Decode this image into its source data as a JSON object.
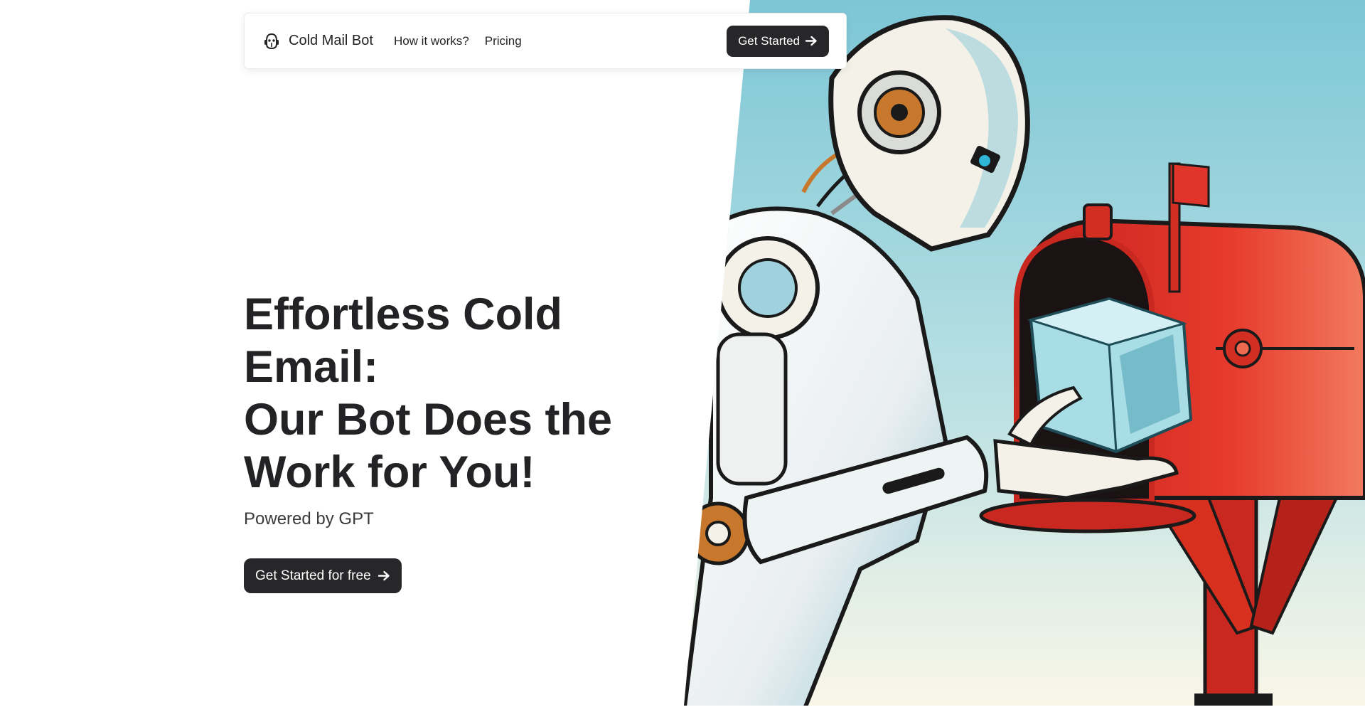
{
  "nav": {
    "brand_name": "Cold Mail Bot",
    "brand_icon": "robot-head-icon",
    "links": [
      "How it works?",
      "Pricing"
    ],
    "cta_label": "Get Started",
    "cta_icon": "arrow-right-icon"
  },
  "hero": {
    "title_lines": [
      "Effortless Cold",
      "Email:",
      "Our Bot Does the",
      "Work for You!"
    ],
    "subtitle": "Powered by GPT",
    "cta_label": "Get Started for free",
    "cta_icon": "arrow-right-icon"
  },
  "illustration": {
    "subject": "robot-placing-ice-cube-in-mailbox",
    "colors": {
      "sky": "#7ec8d8",
      "ground": "#fbf7e8",
      "mailbox_red": "#e0352b",
      "robot_white": "#f3f1e8",
      "outline": "#1a1a1a",
      "ice": "#a8dde6",
      "copper": "#c8782c"
    }
  },
  "colors": {
    "text": "#232326",
    "button_bg": "#27272a",
    "button_text": "#ffffff",
    "background": "#ffffff"
  }
}
